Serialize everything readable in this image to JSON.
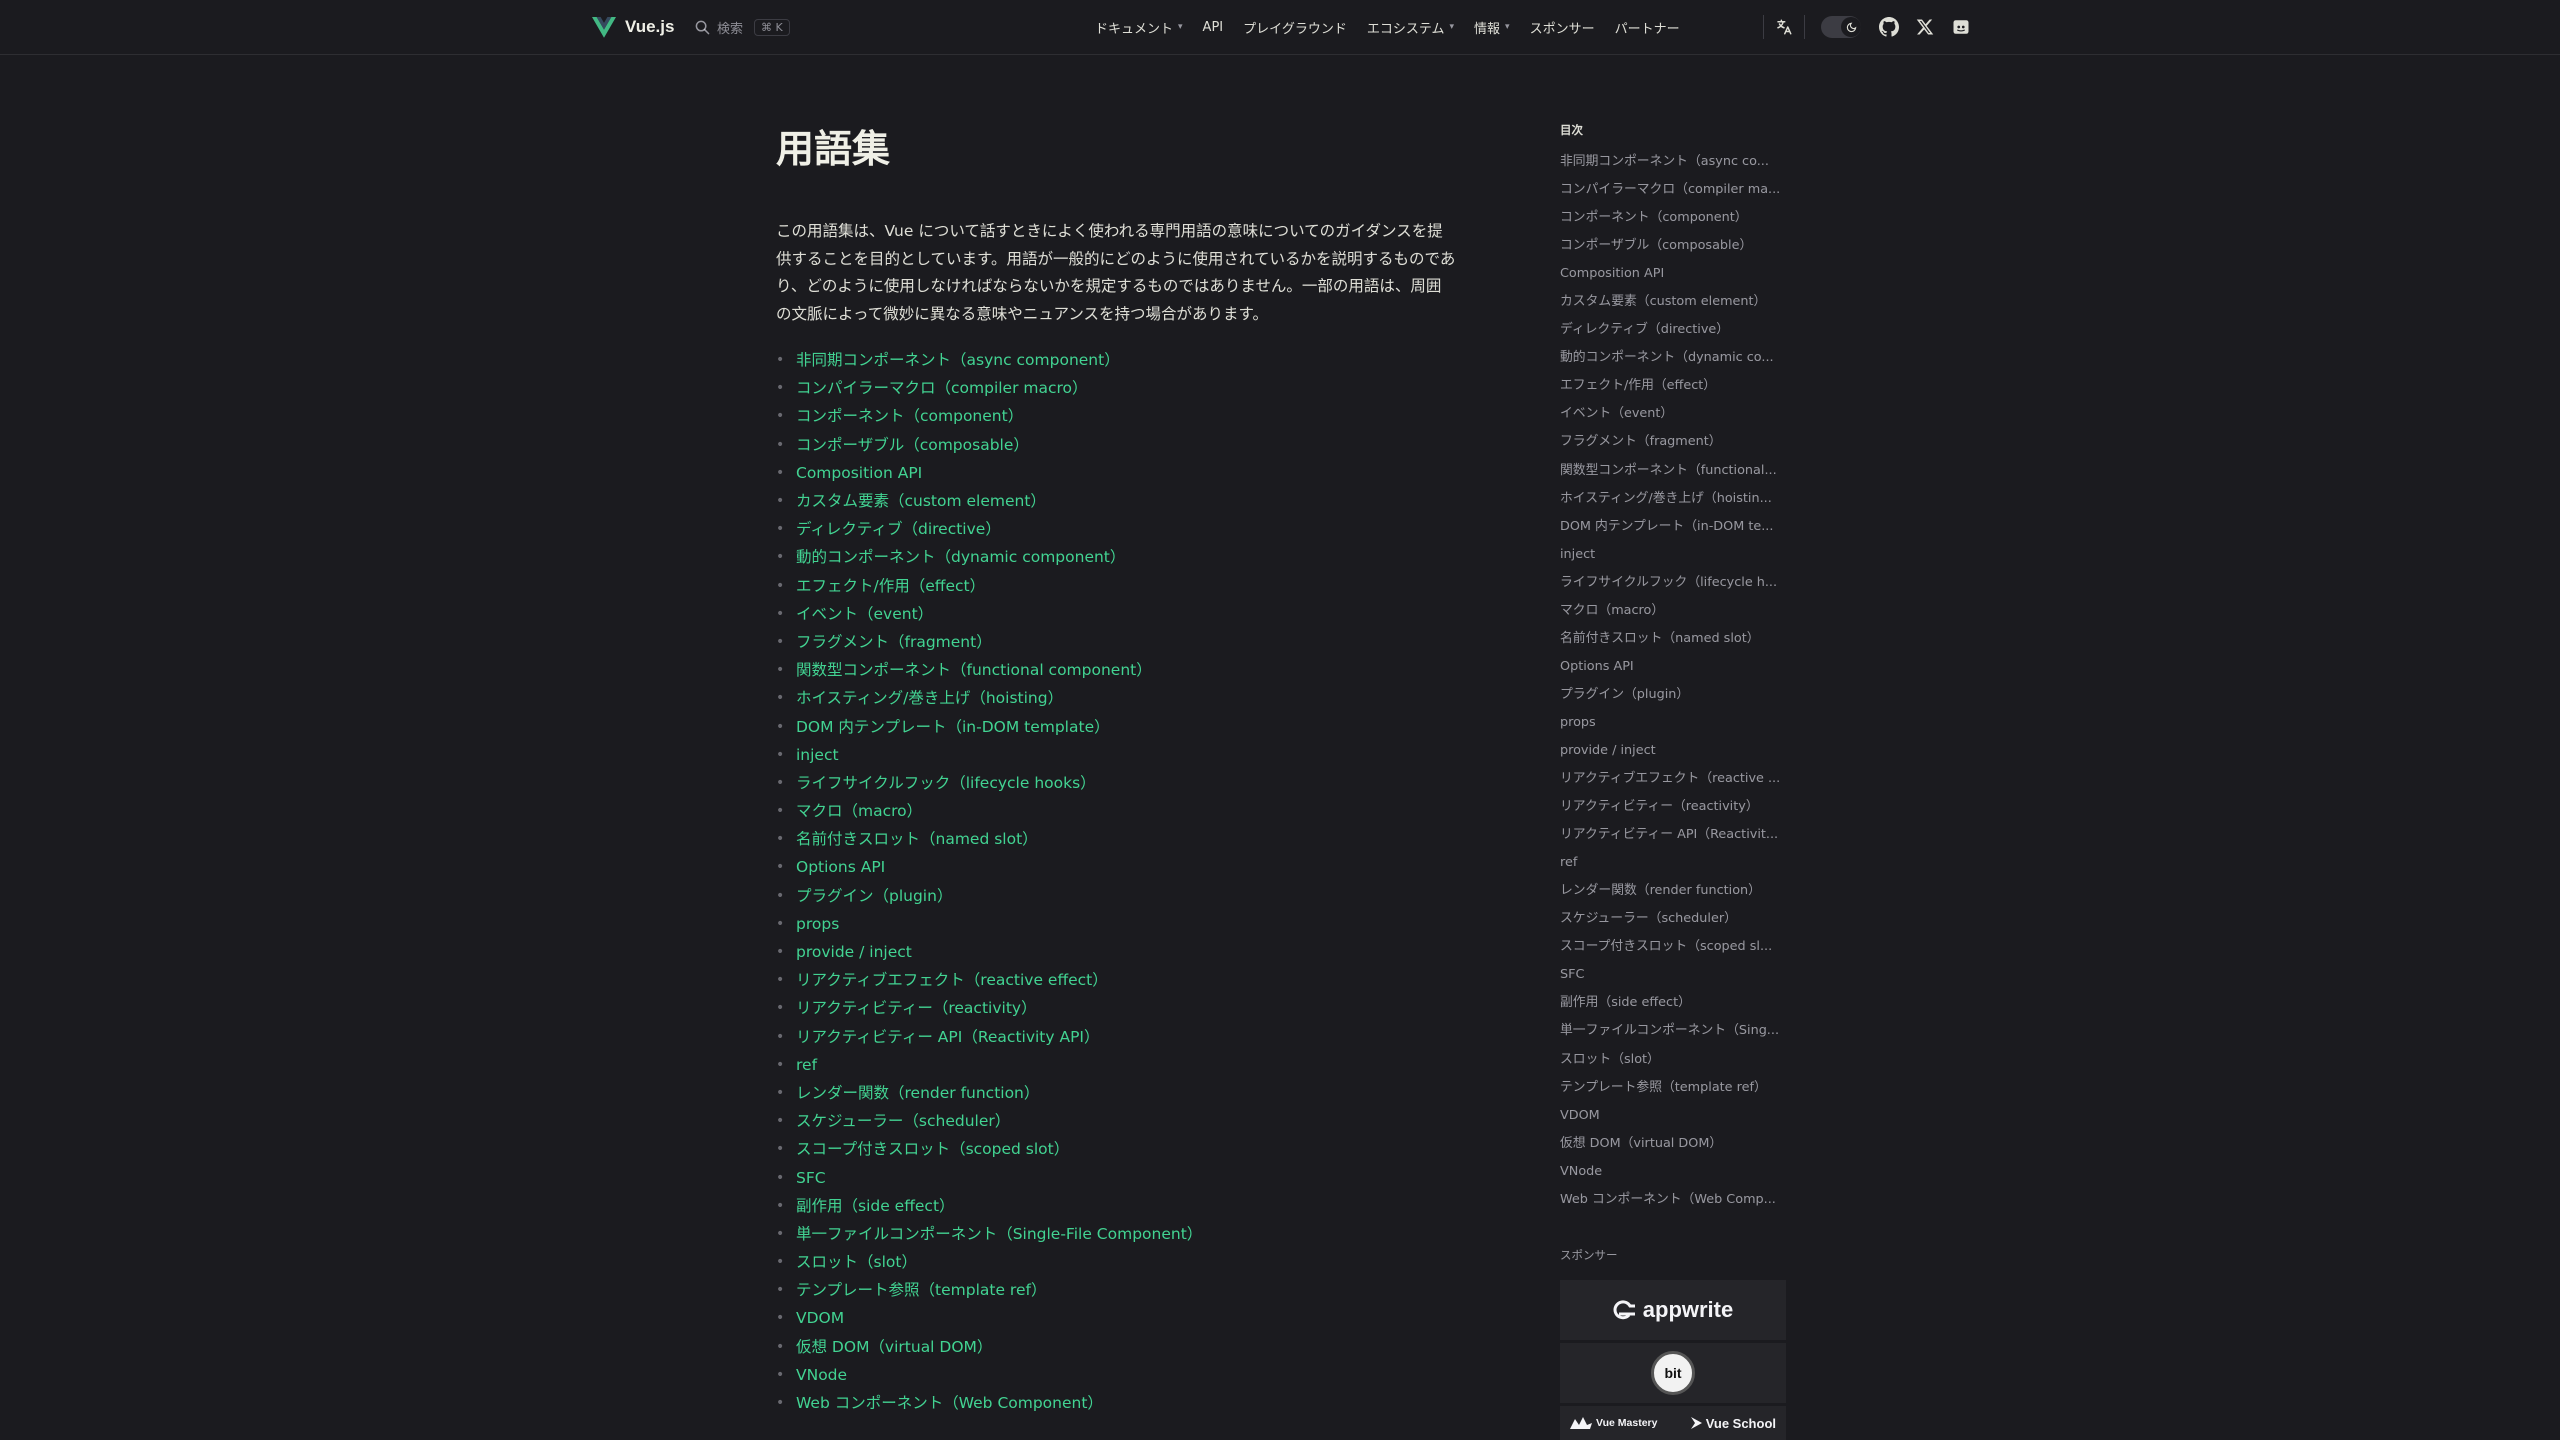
{
  "colors": {
    "accent": "#42d392",
    "background": "#1b1b1f",
    "logo_green": "#42b883",
    "logo_dark": "#35495e"
  },
  "nav": {
    "brand": "Vue.js",
    "search_label": "検索",
    "search_shortcut": "⌘ K",
    "menu": [
      {
        "label": "ドキュメント",
        "dropdown": true
      },
      {
        "label": "API",
        "dropdown": false
      },
      {
        "label": "プレイグラウンド",
        "dropdown": false
      },
      {
        "label": "エコシステム",
        "dropdown": true
      },
      {
        "label": "情報",
        "dropdown": true
      },
      {
        "label": "スポンサー",
        "dropdown": false
      },
      {
        "label": "パートナー",
        "dropdown": false
      }
    ],
    "icons": [
      "translate-icon",
      "theme-toggle",
      "github-icon",
      "x-icon",
      "discord-icon"
    ]
  },
  "page": {
    "title": "用語集",
    "intro": "この用語集は、Vue について話すときによく使われる専門用語の意味についてのガイダンスを提供することを目的としています。用語が一般的にどのように使用されているかを説明するものであり、どのように使用しなければならないかを規定するものではありません。一部の用語は、周囲の文脈によって微妙に異なる意味やニュアンスを持つ場合があります。",
    "terms": [
      "非同期コンポーネント（async component）",
      "コンパイラーマクロ（compiler macro）",
      "コンポーネント（component）",
      "コンポーザブル（composable）",
      "Composition API",
      "カスタム要素（custom element）",
      "ディレクティブ（directive）",
      "動的コンポーネント（dynamic component）",
      "エフェクト/作用（effect）",
      "イベント（event）",
      "フラグメント（fragment）",
      "関数型コンポーネント（functional component）",
      "ホイスティング/巻き上げ（hoisting）",
      "DOM 内テンプレート（in-DOM template）",
      "inject",
      "ライフサイクルフック（lifecycle hooks）",
      "マクロ（macro）",
      "名前付きスロット（named slot）",
      "Options API",
      "プラグイン（plugin）",
      "props",
      "provide / inject",
      "リアクティブエフェクト（reactive effect）",
      "リアクティビティー（reactivity）",
      "リアクティビティー API（Reactivity API）",
      "ref",
      "レンダー関数（render function）",
      "スケジューラー（scheduler）",
      "スコープ付きスロット（scoped slot）",
      "SFC",
      "副作用（side effect）",
      "単一ファイルコンポーネント（Single-File Component）",
      "スロット（slot）",
      "テンプレート参照（template ref）",
      "VDOM",
      "仮想 DOM（virtual DOM）",
      "VNode",
      "Web コンポーネント（Web Component）"
    ]
  },
  "aside": {
    "toc_title": "目次",
    "toc": [
      "非同期コンポーネント（async co...",
      "コンパイラーマクロ（compiler ma...",
      "コンポーネント（component）",
      "コンポーザブル（composable）",
      "Composition API",
      "カスタム要素（custom element）",
      "ディレクティブ（directive）",
      "動的コンポーネント（dynamic co...",
      "エフェクト/作用（effect）",
      "イベント（event）",
      "フラグメント（fragment）",
      "関数型コンポーネント（functional...",
      "ホイスティング/巻き上げ（hoistin...",
      "DOM 内テンプレート（in-DOM te...",
      "inject",
      "ライフサイクルフック（lifecycle h...",
      "マクロ（macro）",
      "名前付きスロット（named slot）",
      "Options API",
      "プラグイン（plugin）",
      "props",
      "provide / inject",
      "リアクティブエフェクト（reactive ...",
      "リアクティビティー（reactivity）",
      "リアクティビティー API（Reactivit...",
      "ref",
      "レンダー関数（render function）",
      "スケジューラー（scheduler）",
      "スコープ付きスロット（scoped sl...",
      "SFC",
      "副作用（side effect）",
      "単一ファイルコンポーネント（Sing...",
      "スロット（slot）",
      "テンプレート参照（template ref）",
      "VDOM",
      "仮想 DOM（virtual DOM）",
      "VNode",
      "Web コンポーネント（Web Comp..."
    ],
    "sponsor_title": "スポンサー",
    "sponsors": {
      "appwrite": "appwrite",
      "bit": "bit",
      "vue_mastery": "Vue Mastery",
      "vue_school": "Vue School"
    }
  }
}
